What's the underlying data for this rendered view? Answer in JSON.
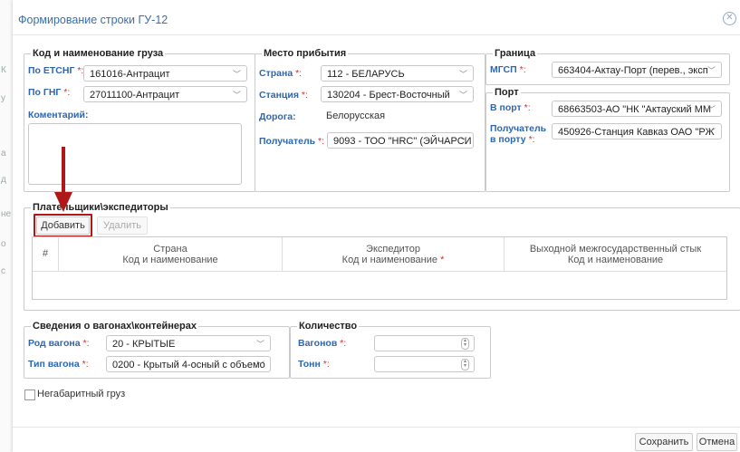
{
  "dialog": {
    "title": "Формирование строки ГУ-12"
  },
  "background": {
    "letters": [
      "К",
      "у",
      "а",
      "д",
      "не",
      "о",
      "с"
    ]
  },
  "cargo": {
    "legend": "Код и наименование груза",
    "etsng_label": "По ЕТСНГ",
    "etsng_value": "161016-Антрацит",
    "gng_label": "По ГНГ",
    "gng_value": "27011100-Антрацит",
    "comment_label": "Коментарий:"
  },
  "arrival": {
    "legend": "Место прибытия",
    "country_label": "Страна",
    "country_value": "112 - БЕЛАРУСЬ",
    "station_label": "Станция",
    "station_value": "130204 - Брест-Восточный",
    "road_label": "Дорога:",
    "road_value": "Белорусская",
    "receiver_label": "Получатель",
    "receiver_value": "9093 - ТОО \"HRC\" (ЭЙЧАРСИ"
  },
  "border": {
    "legend": "Граница",
    "mgsp_label": "МГСП",
    "mgsp_value": "663404-Актау-Порт (перев., эксп"
  },
  "port": {
    "legend": "Порт",
    "to_port_label": "В порт",
    "to_port_value": "68663503-АО \"НК \"Актауский ММ",
    "receiver_label_line1": "Получатель",
    "receiver_label_line2": "в порту",
    "receiver_value": "450926-Станция Кавказ ОАО \"РЖ"
  },
  "payers": {
    "legend": "Плательщики\\экспедиторы",
    "add_label": "Добавить",
    "delete_label": "Удалить",
    "columns": {
      "num": "#",
      "country_line1": "Страна",
      "country_line2": "Код и наименование",
      "forwarder_line1": "Экспедитор",
      "forwarder_line2": "Код и наименование",
      "junction_line1": "Выходной межгосударственный стык",
      "junction_line2": "Код и наименование"
    }
  },
  "wagons": {
    "legend": "Сведения о вагонах\\контейнерах",
    "kind_label": "Род вагона",
    "kind_value": "20 - КРЫТЫЕ",
    "type_label": "Тип вагона",
    "type_value": "0200 - Крытый 4-осный с объемо"
  },
  "quantity": {
    "legend": "Количество",
    "wagons_label": "Вагонов",
    "wagons_value": "",
    "tons_label": "Тонн",
    "tons_value": ""
  },
  "oversized": {
    "label": "Негабаритный груз",
    "checked": false
  },
  "footer": {
    "save_label": "Сохранить",
    "cancel_label": "Отмена"
  },
  "common": {
    "required_mark": "*:",
    "required_star": "*",
    "colon": ":"
  },
  "colors": {
    "accent": "#2e66b0",
    "annotation_red": "#b01818"
  },
  "icons": {
    "dropdown": "chevron-down-icon",
    "close": "close-circle-icon",
    "spinner": "spinner-arrows-icon"
  }
}
